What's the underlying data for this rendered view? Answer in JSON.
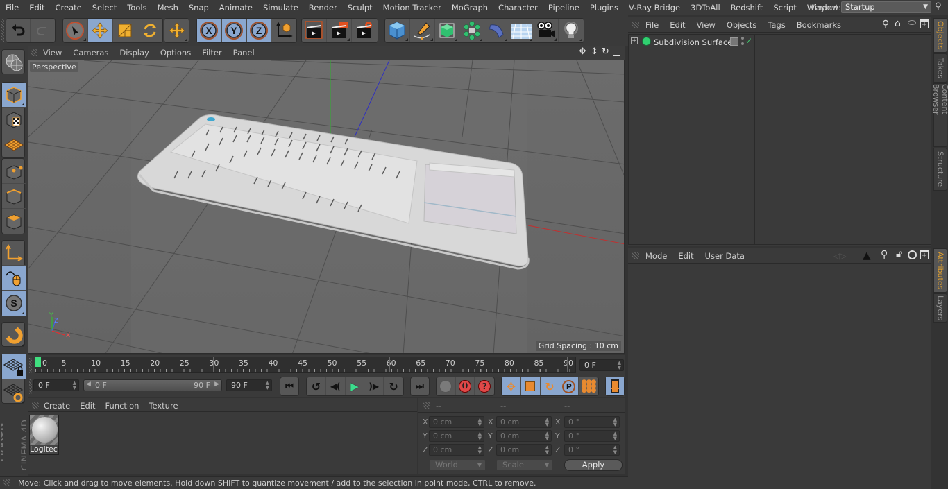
{
  "menubar": {
    "items": [
      "File",
      "Edit",
      "Create",
      "Select",
      "Tools",
      "Mesh",
      "Snap",
      "Animate",
      "Simulate",
      "Render",
      "Sculpt",
      "Motion Tracker",
      "MoGraph",
      "Character",
      "Pipeline",
      "Plugins",
      "V-Ray Bridge",
      "3DToAll",
      "Redshift",
      "Script",
      "Window",
      "Help"
    ],
    "layout_label": "Layout:",
    "layout_value": "Startup"
  },
  "toolbar": {
    "icons": [
      "undo-icon",
      "redo-icon",
      "live-selection-icon",
      "move-icon",
      "scale-icon",
      "rotate-icon",
      "recent-tools-icon",
      "x-axis-lock-icon",
      "y-axis-lock-icon",
      "z-axis-lock-icon",
      "coordinate-system-icon",
      "render-view-icon",
      "render-picture-viewer-icon",
      "render-settings-icon",
      "cube-icon",
      "pen-spline-icon",
      "subdivision-surface-icon",
      "cloner-icon",
      "deformer-icon",
      "floor-environment-icon",
      "camera-icon",
      "light-icon"
    ]
  },
  "viewport": {
    "menu": [
      "View",
      "Cameras",
      "Display",
      "Options",
      "Filter",
      "Panel"
    ],
    "camera_label": "Perspective",
    "grid_spacing": "Grid Spacing : 10 cm",
    "axis_labels": {
      "y": "Y",
      "z": "Z",
      "x": "X"
    }
  },
  "timeline": {
    "ticks": [
      "0",
      "5",
      "10",
      "15",
      "20",
      "25",
      "30",
      "35",
      "40",
      "45",
      "50",
      "55",
      "60",
      "65",
      "70",
      "75",
      "80",
      "85",
      "90"
    ],
    "current_frame_field": "0 F",
    "start_field": "0 F",
    "range_start": "0 F",
    "range_end": "90 F",
    "end_field": "90 F",
    "current_frame": 0,
    "max_frame": 90
  },
  "material_manager": {
    "menu": [
      "Create",
      "Edit",
      "Function",
      "Texture"
    ],
    "materials": [
      {
        "name": "Logitech"
      }
    ]
  },
  "coordinates": {
    "headers": [
      "--",
      "--",
      "--"
    ],
    "rows": [
      {
        "axis": "X",
        "pos": "0 cm",
        "size": "0 cm",
        "rot": "0 °"
      },
      {
        "axis": "Y",
        "pos": "0 cm",
        "size": "0 cm",
        "rot": "0 °"
      },
      {
        "axis": "Z",
        "pos": "0 cm",
        "size": "0 cm",
        "rot": "0 °"
      }
    ],
    "space_dropdown": "World",
    "mode_dropdown": "Scale",
    "apply_label": "Apply"
  },
  "status": {
    "message": "Move: Click and drag to move elements. Hold down SHIFT to quantize movement / add to the selection in point mode, CTRL to remove."
  },
  "object_manager": {
    "menu": [
      "File",
      "Edit",
      "View",
      "Objects",
      "Tags",
      "Bookmarks"
    ],
    "objects": [
      {
        "name": "Subdivision Surface",
        "enabled": true
      }
    ]
  },
  "attributes": {
    "menu": [
      "Mode",
      "Edit",
      "User Data"
    ]
  },
  "right_tabs": {
    "top": [
      "Objects",
      "Takes",
      "Content Browser",
      "Structure"
    ],
    "bottom": [
      "Attributes",
      "Layers"
    ]
  },
  "branding": {
    "maxon": "MAXON",
    "product": "CINEMA 4D"
  },
  "colors": {
    "accent_blue": "#8aa7cf",
    "accent_orange": "#e8a030",
    "active_tab": "#e0a030",
    "play_green": "#3cdc8c",
    "x_axis": "#c83232",
    "y_axis": "#32a032",
    "z_axis": "#3232c8"
  }
}
